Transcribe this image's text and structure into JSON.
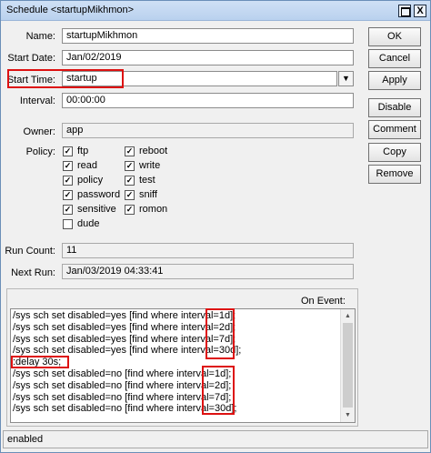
{
  "window": {
    "title": "Schedule <startupMikhmon>",
    "close_glyph": "X"
  },
  "form": {
    "name": {
      "label": "Name:",
      "value": "startupMikhmon"
    },
    "start_date": {
      "label": "Start Date:",
      "value": "Jan/02/2019"
    },
    "start_time": {
      "label": "Start Time:",
      "value": "startup",
      "dropdown_glyph": "▼"
    },
    "interval": {
      "label": "Interval:",
      "value": "00:00:00"
    },
    "owner": {
      "label": "Owner:",
      "value": "app"
    },
    "policy_label": "Policy:",
    "policies": [
      {
        "label": "ftp",
        "checked": true
      },
      {
        "label": "reboot",
        "checked": true
      },
      {
        "label": "read",
        "checked": true
      },
      {
        "label": "write",
        "checked": true
      },
      {
        "label": "policy",
        "checked": true
      },
      {
        "label": "test",
        "checked": true
      },
      {
        "label": "password",
        "checked": true
      },
      {
        "label": "sniff",
        "checked": true
      },
      {
        "label": "sensitive",
        "checked": true
      },
      {
        "label": "romon",
        "checked": true
      },
      {
        "label": "dude",
        "checked": false
      }
    ],
    "run_count": {
      "label": "Run Count:",
      "value": "11"
    },
    "next_run": {
      "label": "Next Run:",
      "value": "Jan/03/2019 04:33:41"
    },
    "on_event": {
      "label": "On Event:",
      "lines": [
        "/sys sch set disabled=yes [find where interval=1d];",
        "/sys sch set disabled=yes [find where interval=2d];",
        "/sys sch set disabled=yes [find where interval=7d];",
        "/sys sch set disabled=yes [find where interval=30d];",
        ":delay 30s;",
        "/sys sch set disabled=no [find where interval=1d];",
        "/sys sch set disabled=no [find where interval=2d];",
        "/sys sch set disabled=no [find where interval=7d];",
        "/sys sch set disabled=no [find where interval=30d];"
      ]
    }
  },
  "buttons": {
    "ok": "OK",
    "cancel": "Cancel",
    "apply": "Apply",
    "disable": "Disable",
    "comment": "Comment",
    "copy": "Copy",
    "remove": "Remove"
  },
  "status": {
    "text": "enabled"
  },
  "colors": {
    "highlight": "#d11111",
    "titlebar": "#c4d9f1"
  }
}
